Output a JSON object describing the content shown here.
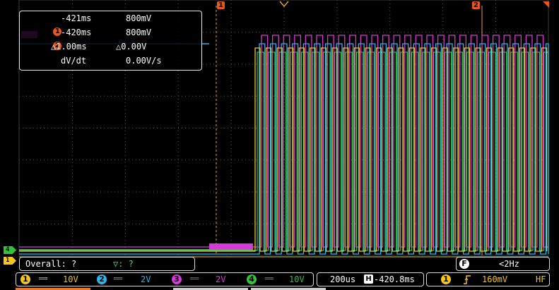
{
  "cursor_readout": {
    "row1": {
      "marker": "1",
      "time": "-421ms",
      "volt": "800mV"
    },
    "row2": {
      "marker": "2",
      "time": "-420ms",
      "volt": "800mV"
    },
    "delta": {
      "time": "△1.00ms",
      "volt": "△0.00V"
    },
    "slope": {
      "label": "dV/dt",
      "value": "0.00V/s"
    }
  },
  "top_markers": {
    "cursor1": "1",
    "cursor2": "2"
  },
  "left_markers": {
    "ch4": "4",
    "ch1": "1"
  },
  "trigger_bar": {
    "overall_label": "Overall: ?",
    "filter_label": "▽: ?",
    "f_badge": "F",
    "freq": "<2Hz"
  },
  "channel_bar": {
    "ch1": {
      "num": "1",
      "coupling": "══",
      "scale": "10V",
      "color": "#f5c518"
    },
    "ch2": {
      "num": "2",
      "coupling": "══",
      "scale": "2V",
      "color": "#2bb5e8"
    },
    "ch3": {
      "num": "3",
      "coupling": "══",
      "scale": "2V",
      "color": "#d63ad6"
    },
    "ch4": {
      "num": "4",
      "coupling": "══",
      "scale": "10V",
      "color": "#33c23a"
    },
    "timebase": "200us",
    "h_badge": "H",
    "h_position": "-420.8ms",
    "trigger": {
      "source": "1",
      "slope_icon": "rising-edge",
      "level": "160mV",
      "coupling": "HF"
    }
  }
}
